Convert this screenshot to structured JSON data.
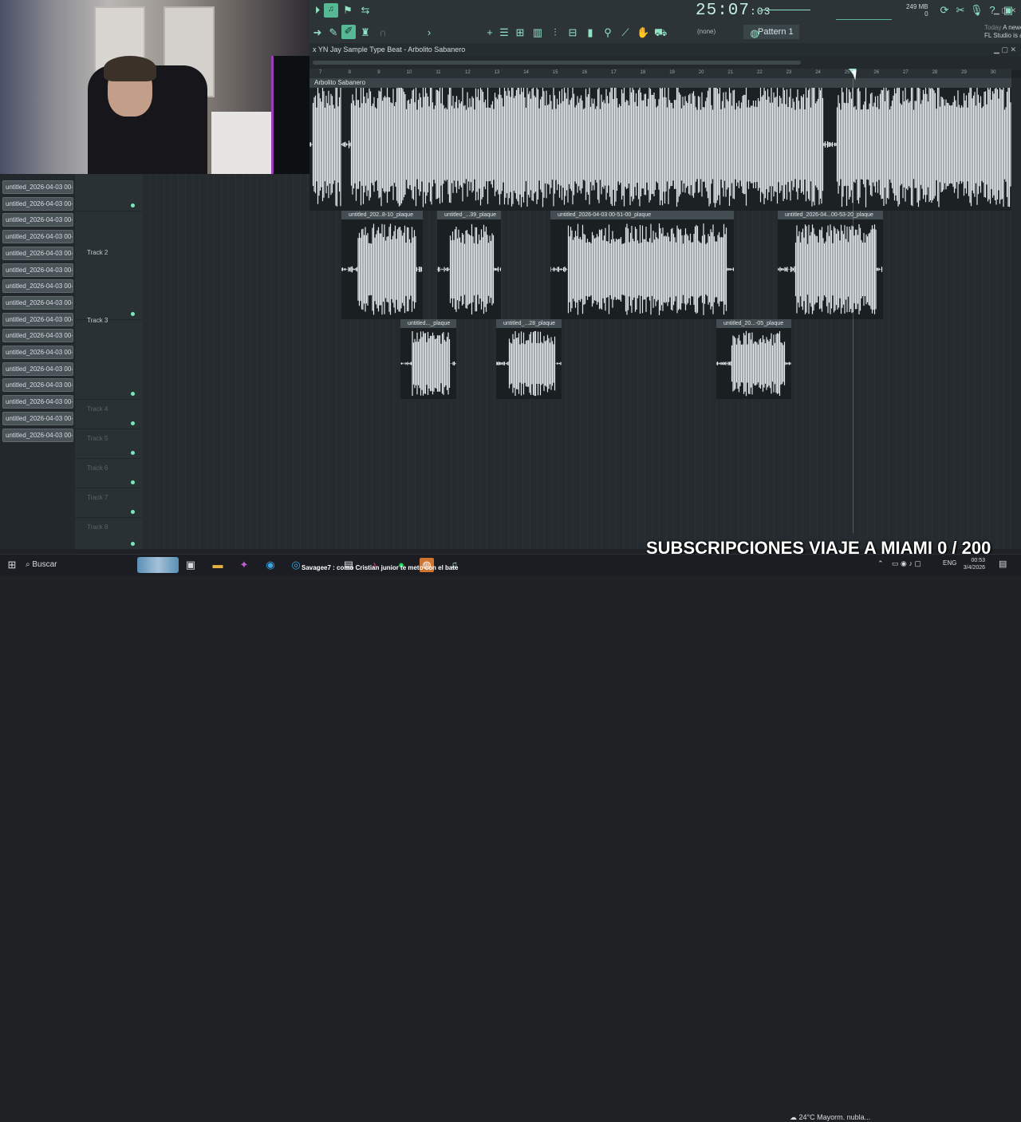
{
  "app": {
    "project_title": "x YN Jay Sample Type Beat - Arbolito Sabanero",
    "time_display": "25:07",
    "time_ms": "03",
    "memory": "249 MB",
    "memory_sub": "0",
    "snap": "(none)",
    "pattern": "Pattern 1",
    "news_today": "Today",
    "news_text": "A newer version of FL Studio is available!"
  },
  "ruler": [
    "7",
    "8",
    "9",
    "10",
    "11",
    "12",
    "13",
    "14",
    "15",
    "16",
    "17",
    "18",
    "19",
    "20",
    "21",
    "22",
    "23",
    "24",
    "25",
    "26",
    "27",
    "28",
    "29",
    "30"
  ],
  "picker_items": [
    "untitled_2026-04-03 00-...",
    "untitled_2026-04-03 00-...",
    "untitled_2026-04-03 00-...",
    "untitled_2026-04-03 00-...",
    "untitled_2026-04-03 00-...",
    "untitled_2026-04-03 00-...",
    "untitled_2026-04-03 00-...",
    "untitled_2026-04-03 00-...",
    "untitled_2026-04-03 00-...",
    "untitled_2026-04-03 00-...",
    "untitled_2026-04-03 00-...",
    "untitled_2026-04-03 00-...",
    "untitled_2026-04-03 00-...",
    "untitled_2026-04-03 00-...",
    "untitled_2026-04-03 00-...",
    "untitled_2026-04-03 00-..."
  ],
  "tracks": [
    {
      "name": ""
    },
    {
      "name": "Track 2"
    },
    {
      "name": "Track 3"
    },
    {
      "name": "Track 4"
    },
    {
      "name": "Track 5"
    },
    {
      "name": "Track 6"
    },
    {
      "name": "Track 7"
    },
    {
      "name": "Track 8"
    }
  ],
  "track1_clip": "Arbolito Sabanero",
  "clips": [
    "untitled_202..8-10_plaque",
    "untitled_...39_plaque",
    "untitled_2026-04-03 00-51-00_plaque",
    "untitled_2026-04...00-53-20_plaque",
    "untitled..._plaque",
    "untitled_...28_plaque",
    "untitled_20...-05_plaque"
  ],
  "overlay": {
    "subs": "SUBSCRIPCIONES VIAJE A MIAMI 0 / 200"
  },
  "taskbar": {
    "search": "Buscar",
    "notification": "Savagee7 : como Cristian junior te meto con el bate",
    "weather_temp": "24°C",
    "weather_text": "Mayorm. nubla...",
    "lang": "ENG",
    "time": "00:53",
    "date": "3/4/2026"
  },
  "colors": {
    "accent": "#7de6bd",
    "wave": "#e4e8ec",
    "bg": "#1e2225"
  }
}
